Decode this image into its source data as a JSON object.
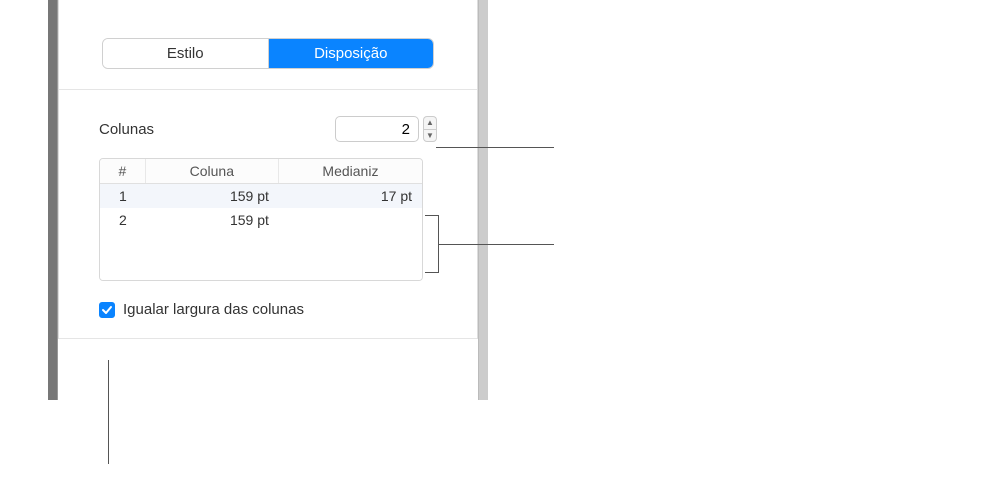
{
  "tabs": {
    "style": "Estilo",
    "layout": "Disposição"
  },
  "columns_section": {
    "label": "Colunas",
    "count": "2"
  },
  "table": {
    "headers": {
      "num": "#",
      "column": "Coluna",
      "gutter": "Medianiz"
    },
    "rows": [
      {
        "num": "1",
        "column": "159 pt",
        "gutter": "17 pt"
      },
      {
        "num": "2",
        "column": "159 pt",
        "gutter": ""
      }
    ]
  },
  "equal_width": {
    "label": "Igualar largura das colunas",
    "checked": true
  }
}
